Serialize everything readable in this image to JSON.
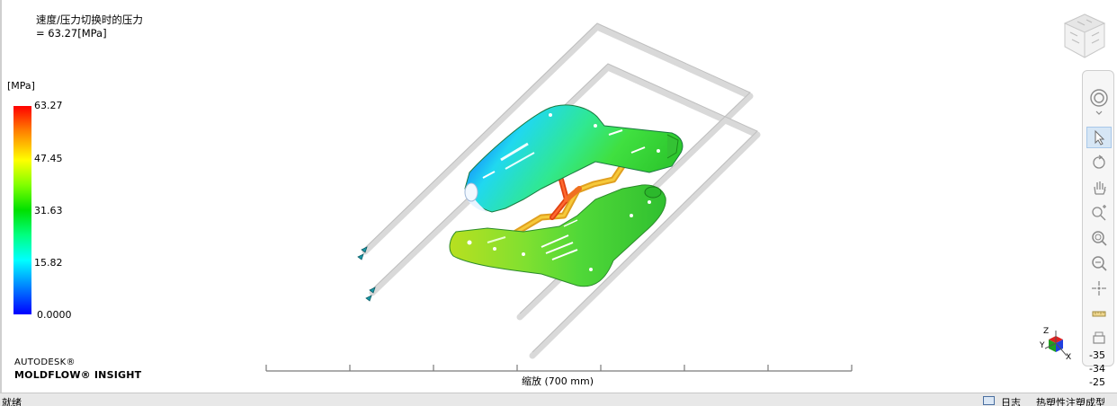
{
  "result": {
    "title": "速度/压力切换时的压力",
    "value": " =  63.27[MPa]"
  },
  "legend": {
    "unit": "[MPa]",
    "ticks": [
      "63.27",
      "47.45",
      "31.63",
      "15.82",
      "0.0000"
    ]
  },
  "branding": {
    "line1": "AUTODESK®",
    "line2": "MOLDFLOW® INSIGHT"
  },
  "scale": {
    "label": "缩放 (700 mm)"
  },
  "axes": {
    "x": "X",
    "y": "Y",
    "z": "Z",
    "numbers": [
      "-35",
      "-34",
      "-25"
    ]
  },
  "toolbar": {
    "items": [
      {
        "icon": "steering-wheel-icon"
      },
      {
        "icon": "select-arrow-icon"
      },
      {
        "icon": "rotate-icon"
      },
      {
        "icon": "pan-hand-icon"
      },
      {
        "icon": "zoom-dynamic-icon"
      },
      {
        "icon": "zoom-window-icon"
      },
      {
        "icon": "zoom-all-icon"
      },
      {
        "icon": "center-icon"
      },
      {
        "icon": "measure-icon"
      },
      {
        "icon": "print-icon"
      }
    ]
  },
  "status": {
    "left": "就绪",
    "date": "日志",
    "right": "热塑性注塑成型"
  },
  "colors": {
    "max": "#ff0000",
    "mid": "#00e000",
    "min": "#0000ff",
    "pipe": "#d6d6d6"
  }
}
